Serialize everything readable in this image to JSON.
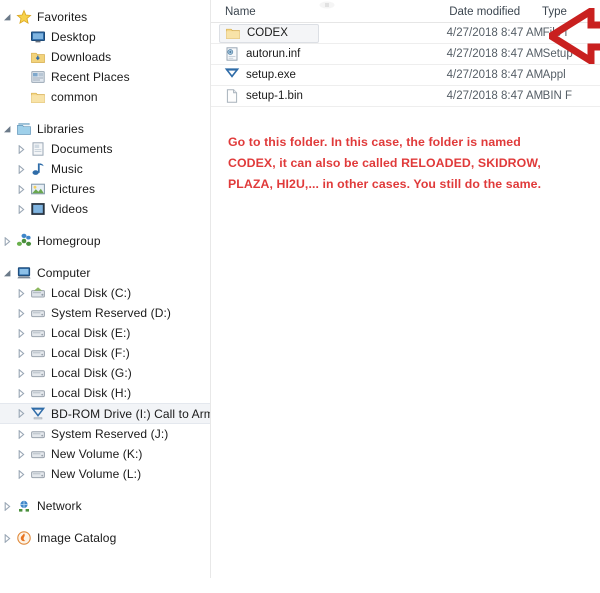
{
  "colors": {
    "annotation_red": "#e03a3a",
    "arrow_red": "#c9201f",
    "folder_yellow": "#f5d67b",
    "selection_bg": "#f4f5f7",
    "text": "#1a1a1a"
  },
  "sidebar": {
    "groups": [
      {
        "name": "favorites",
        "label": "Favorites",
        "icon": "star-icon",
        "expanded": true,
        "items": [
          {
            "label": "Desktop",
            "icon": "desktop-icon",
            "twisty": false
          },
          {
            "label": "Downloads",
            "icon": "downloads-folder-icon",
            "twisty": false
          },
          {
            "label": "Recent Places",
            "icon": "recent-places-icon",
            "twisty": false
          },
          {
            "label": "common",
            "icon": "folder-icon",
            "twisty": false
          }
        ]
      },
      {
        "name": "libraries",
        "label": "Libraries",
        "icon": "libraries-icon",
        "expanded": true,
        "items": [
          {
            "label": "Documents",
            "icon": "documents-library-icon",
            "twisty": true
          },
          {
            "label": "Music",
            "icon": "music-library-icon",
            "twisty": true
          },
          {
            "label": "Pictures",
            "icon": "pictures-library-icon",
            "twisty": true
          },
          {
            "label": "Videos",
            "icon": "videos-library-icon",
            "twisty": true
          }
        ]
      },
      {
        "name": "homegroup",
        "label": "Homegroup",
        "icon": "homegroup-icon",
        "expanded": false,
        "items": []
      },
      {
        "name": "computer",
        "label": "Computer",
        "icon": "computer-icon",
        "expanded": true,
        "items": [
          {
            "label": "Local Disk (C:)",
            "icon": "system-drive-icon",
            "twisty": true
          },
          {
            "label": "System Reserved (D:)",
            "icon": "drive-icon",
            "twisty": true
          },
          {
            "label": "Local Disk (E:)",
            "icon": "drive-icon",
            "twisty": true
          },
          {
            "label": "Local Disk (F:)",
            "icon": "drive-icon",
            "twisty": true
          },
          {
            "label": "Local Disk (G:)",
            "icon": "drive-icon",
            "twisty": true
          },
          {
            "label": "Local Disk (H:)",
            "icon": "drive-icon",
            "twisty": true
          },
          {
            "label": "BD-ROM Drive (I:) Call to Arms",
            "icon": "bd-rom-drive-icon",
            "twisty": true,
            "selected": true
          },
          {
            "label": "System Reserved (J:)",
            "icon": "drive-icon",
            "twisty": true
          },
          {
            "label": "New Volume (K:)",
            "icon": "drive-icon",
            "twisty": true
          },
          {
            "label": "New Volume (L:)",
            "icon": "drive-icon",
            "twisty": true
          }
        ]
      },
      {
        "name": "network",
        "label": "Network",
        "icon": "network-icon",
        "expanded": false,
        "items": []
      },
      {
        "name": "image-catalog",
        "label": "Image Catalog",
        "icon": "image-catalog-icon",
        "expanded": false,
        "items": []
      }
    ]
  },
  "filelist": {
    "columns": {
      "name": "Name",
      "date_modified": "Date modified",
      "type": "Type"
    },
    "sort_indicator": "sort-ascending-icon",
    "rows": [
      {
        "name": "CODEX",
        "date": "4/27/2018 8:47 AM",
        "type": "File f",
        "icon": "folder-icon",
        "selected": true
      },
      {
        "name": "autorun.inf",
        "date": "4/27/2018 8:47 AM",
        "type": "Setup",
        "icon": "setup-information-icon",
        "selected": false
      },
      {
        "name": "setup.exe",
        "date": "4/27/2018 8:47 AM",
        "type": "Appl",
        "icon": "application-icon",
        "selected": false
      },
      {
        "name": "setup-1.bin",
        "date": "4/27/2018 8:47 AM",
        "type": "BIN F",
        "icon": "bin-file-icon",
        "selected": false
      }
    ]
  },
  "annotation": {
    "icon": "left-arrow-annotation",
    "lines": [
      "Go to this folder. In this case, the folder is named",
      "CODEX, it can also be called RELOADED, SKIDROW,",
      "PLAZA, HI2U,... in other cases. You still do the same."
    ]
  }
}
